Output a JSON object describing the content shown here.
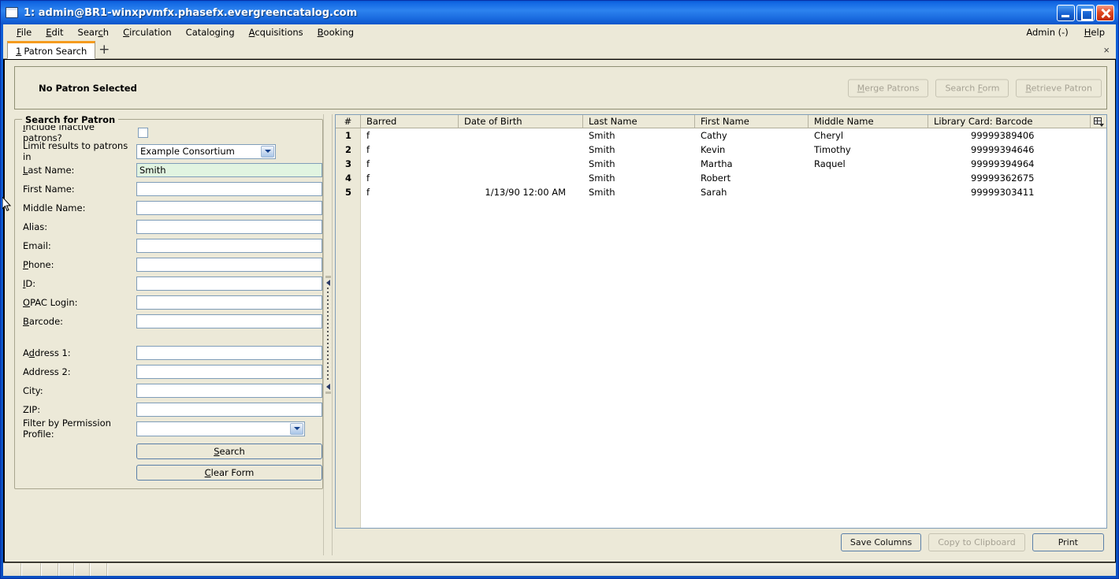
{
  "window": {
    "title": "1: admin@BR1-winxpvmfx.phasefx.evergreencatalog.com",
    "icon": "window-icon",
    "minimize": "minimize-icon",
    "maximize": "maximize-icon",
    "close": "close-icon"
  },
  "menubar": {
    "items": [
      {
        "label": "File",
        "accel": "F"
      },
      {
        "label": "Edit",
        "accel": "E"
      },
      {
        "label": "Search",
        "accel": "c"
      },
      {
        "label": "Circulation",
        "accel": "C"
      },
      {
        "label": "Cataloging",
        "accel": "g"
      },
      {
        "label": "Acquisitions",
        "accel": "A"
      },
      {
        "label": "Booking",
        "accel": "B"
      }
    ],
    "right": [
      {
        "label": "Admin (-)",
        "accel": ""
      },
      {
        "label": "Help",
        "accel": "H"
      }
    ]
  },
  "tabs": {
    "items": [
      {
        "number": "1",
        "label": "Patron Search",
        "active": true
      }
    ],
    "add_label": "+",
    "close_label": "×"
  },
  "patron_bar": {
    "status": "No Patron Selected",
    "buttons": [
      {
        "label": "Merge Patrons",
        "pre": "M",
        "post": "erge Patrons",
        "disabled": true
      },
      {
        "label": "Search Form",
        "pre": "Search ",
        "post": "F",
        "tail": "orm",
        "disabled": true
      },
      {
        "label": "Retrieve Patron",
        "pre": "R",
        "post": "etrieve Patron",
        "disabled": true
      }
    ]
  },
  "search_form": {
    "legend": "Search for Patron",
    "fields": {
      "include_inactive_label": "Include inactive patrons?",
      "include_inactive_checked": false,
      "limit_label": "Limit results to patrons in",
      "limit_value": "Example Consortium",
      "last_name_label": "Last Name:",
      "last_name_value": "Smith",
      "first_name_label": "First Name:",
      "first_name_value": "",
      "middle_name_label": "Middle Name:",
      "middle_name_value": "",
      "alias_label": "Alias:",
      "alias_value": "",
      "email_label": "Email:",
      "email_value": "",
      "phone_label": "Phone:",
      "phone_value": "",
      "id_label": "ID:",
      "id_value": "",
      "opac_login_label": "OPAC Login:",
      "opac_login_value": "",
      "barcode_label": "Barcode:",
      "barcode_value": "",
      "address1_label": "Address 1:",
      "address1_value": "",
      "address2_label": "Address 2:",
      "address2_value": "",
      "city_label": "City:",
      "city_value": "",
      "zip_label": "ZIP:",
      "zip_value": "",
      "permission_profile_label": "Filter by Permission Profile:",
      "permission_profile_value": ""
    },
    "search_button": "Search",
    "clear_button": "Clear Form"
  },
  "results": {
    "columns": [
      "#",
      "Barred",
      "Date of Birth",
      "Last Name",
      "First Name",
      "Middle Name",
      "Library Card: Barcode"
    ],
    "column_picker_icon": "column-picker-icon",
    "rows": [
      {
        "num": "1",
        "barred": "f",
        "dob": "",
        "last": "Smith",
        "first": "Cathy",
        "middle": "Cheryl",
        "card": "99999389406"
      },
      {
        "num": "2",
        "barred": "f",
        "dob": "",
        "last": "Smith",
        "first": "Kevin",
        "middle": "Timothy",
        "card": "99999394646"
      },
      {
        "num": "3",
        "barred": "f",
        "dob": "",
        "last": "Smith",
        "first": "Martha",
        "middle": "Raquel",
        "card": "99999394964"
      },
      {
        "num": "4",
        "barred": "f",
        "dob": "",
        "last": "Smith",
        "first": "Robert",
        "middle": "",
        "card": "99999362675"
      },
      {
        "num": "5",
        "barred": "f",
        "dob": "1/13/90 12:00 AM",
        "last": "Smith",
        "first": "Sarah",
        "middle": "",
        "card": "99999303411"
      }
    ],
    "footer_buttons": [
      {
        "label": "Save Columns",
        "disabled": false
      },
      {
        "label": "Copy to Clipboard",
        "disabled": true
      },
      {
        "label": "Print",
        "disabled": false
      }
    ]
  },
  "colors": {
    "title_bar": "#1267e3",
    "face": "#ece9d8",
    "active_tab_accent": "#f59b1e",
    "focused_field": "#e1f4e1",
    "field_border": "#7f9db9"
  }
}
